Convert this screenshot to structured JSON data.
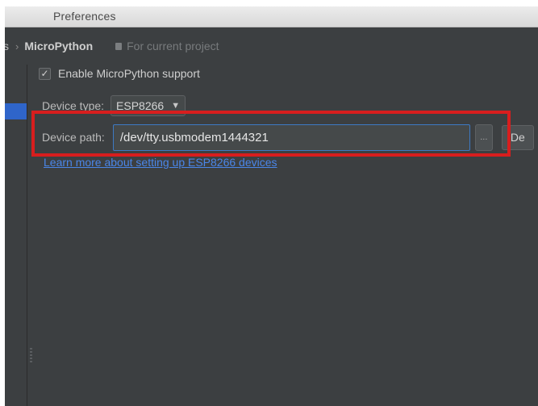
{
  "window": {
    "title": "Preferences"
  },
  "breadcrumb": {
    "previous": "s",
    "separator": "›",
    "current": "MicroPython",
    "scope": "For current project",
    "scope_icon": "document-icon"
  },
  "settings": {
    "enable_checkbox": {
      "label": "Enable MicroPython support",
      "checked": true
    },
    "device_type": {
      "label": "Device type:",
      "value": "ESP8266"
    },
    "device_path": {
      "label": "Device path:",
      "value": "/dev/tty.usbmodem1444321",
      "browse_label": "...",
      "detect_label": "De"
    },
    "learn_more_link": "Learn more about setting up ESP8266 devices"
  },
  "colors": {
    "background": "#3c3f41",
    "highlight": "#d81e1e",
    "link": "#4a86e8",
    "selection": "#2f65ca"
  }
}
